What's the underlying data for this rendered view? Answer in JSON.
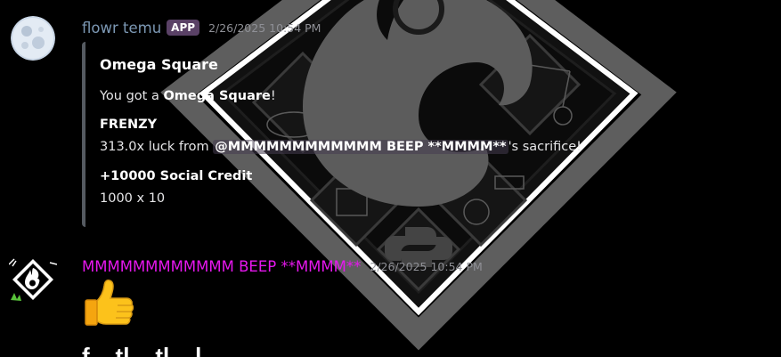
{
  "messages": [
    {
      "username": "flowr temu",
      "badge": "APP",
      "timestamp": "2/26/2025 10:54 PM",
      "embed": {
        "title": "Omega Square",
        "line1_prefix": "You got a ",
        "line1_bold": "Omega Square",
        "line1_suffix": "!",
        "section1_title": "FRENZY",
        "section1_prefix": "313.0x luck from ",
        "section1_mention": "@MMMMMMMMMMMM BEEP **MMMM**",
        "section1_suffix": "'s sacrifice!",
        "section2_title": "+10000 Social Credit",
        "section2_value": "1000 x 10"
      }
    },
    {
      "username": "MMMMMMMMMMMM BEEP **MMMM**",
      "timestamp": "2/26/2025 10:54 PM",
      "reaction_emoji": "thumbs-up",
      "cut_text": "f ... tl... d..."
    }
  ],
  "colors": {
    "background": "#000000",
    "username1": "#7c98b4",
    "username2": "#e617ee",
    "app_badge": "#5a4166",
    "timestamp": "#8f9096",
    "embed_border": "#555a61"
  }
}
